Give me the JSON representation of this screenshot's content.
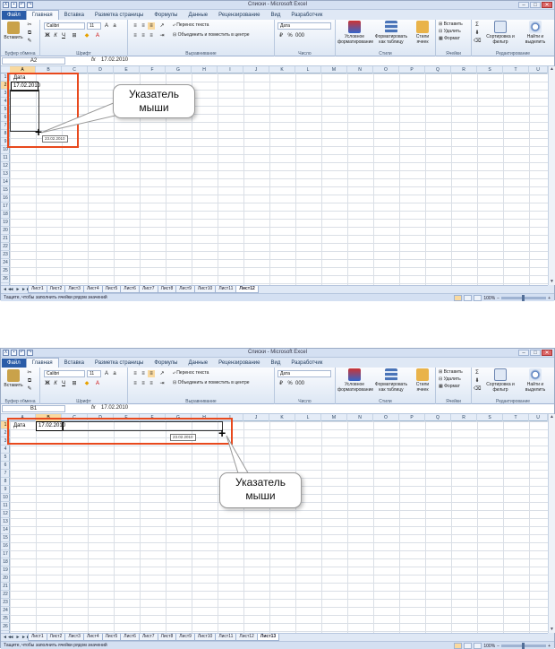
{
  "app_title": "Списки - Microsoft Excel",
  "window_buttons": [
    "–",
    "□",
    "✕"
  ],
  "tabs": [
    "Файл",
    "Главная",
    "Вставка",
    "Разметка страницы",
    "Формулы",
    "Данные",
    "Рецензирование",
    "Вид",
    "Разработчик"
  ],
  "ribbon": {
    "paste_label": "Вставить",
    "clipboard_group": "Буфер обмена",
    "font_name": "Calibri",
    "font_size": "11",
    "bold": "Ж",
    "italic": "К",
    "underline": "Ч",
    "font_group": "Шрифт",
    "wrap_text": "Перенос текста",
    "merge_center": "Объединить и поместить в центре",
    "alignment_group": "Выравнивание",
    "number_format": "Дата",
    "number_group": "Число",
    "conditional_formatting": "Условное форматирование",
    "format_as_table": "Форматировать как таблицу",
    "cell_styles": "Стили ячеек",
    "styles_group": "Стили",
    "insert_cells": "Вставить",
    "delete_cells": "Удалить",
    "format_cells": "Формат",
    "cells_group": "Ячейки",
    "sort_filter": "Сортировка и фильтр",
    "find_select": "Найти и выделить",
    "editing_group": "Редактирование"
  },
  "columns": [
    "A",
    "B",
    "C",
    "D",
    "E",
    "F",
    "G",
    "H",
    "I",
    "J",
    "K",
    "L",
    "M",
    "N",
    "O",
    "P",
    "Q",
    "R",
    "S",
    "T",
    "U"
  ],
  "rows": [
    "1",
    "2",
    "3",
    "4",
    "5",
    "6",
    "7",
    "8",
    "9",
    "10",
    "11",
    "12",
    "13",
    "14",
    "15",
    "16",
    "17",
    "18",
    "19",
    "20",
    "21",
    "22",
    "23",
    "24",
    "25",
    "26"
  ],
  "sheets": [
    "Лист1",
    "Лист2",
    "Лист3",
    "Лист4",
    "Лист5",
    "Лист6",
    "Лист7",
    "Лист8",
    "Лист9",
    "Лист10",
    "Лист11",
    "Лист12"
  ],
  "status_text": "Тащите, чтобы заполнить ячейки рядом значений",
  "zoom": "100%",
  "windows": [
    {
      "name_box": "A2",
      "formula_value": "17.02.2010",
      "active_sheet": "Лист12",
      "cell_header": "Дата",
      "cell_value": "17.02.2010",
      "fill_tooltip": "23.02.2010",
      "callout_text": "Указатель мыши"
    },
    {
      "name_box": "B1",
      "formula_value": "17.02.2010",
      "active_sheet": "Лист13",
      "cell_header": "Дата",
      "cell_value": "17.02.2010",
      "fill_tooltip": "23.02.2010",
      "callout_text": "Указатель мыши"
    }
  ],
  "colors": {
    "accent": "#2a5ca8",
    "highlight_box": "#e8491d",
    "selected_header": "#f9d99f"
  }
}
